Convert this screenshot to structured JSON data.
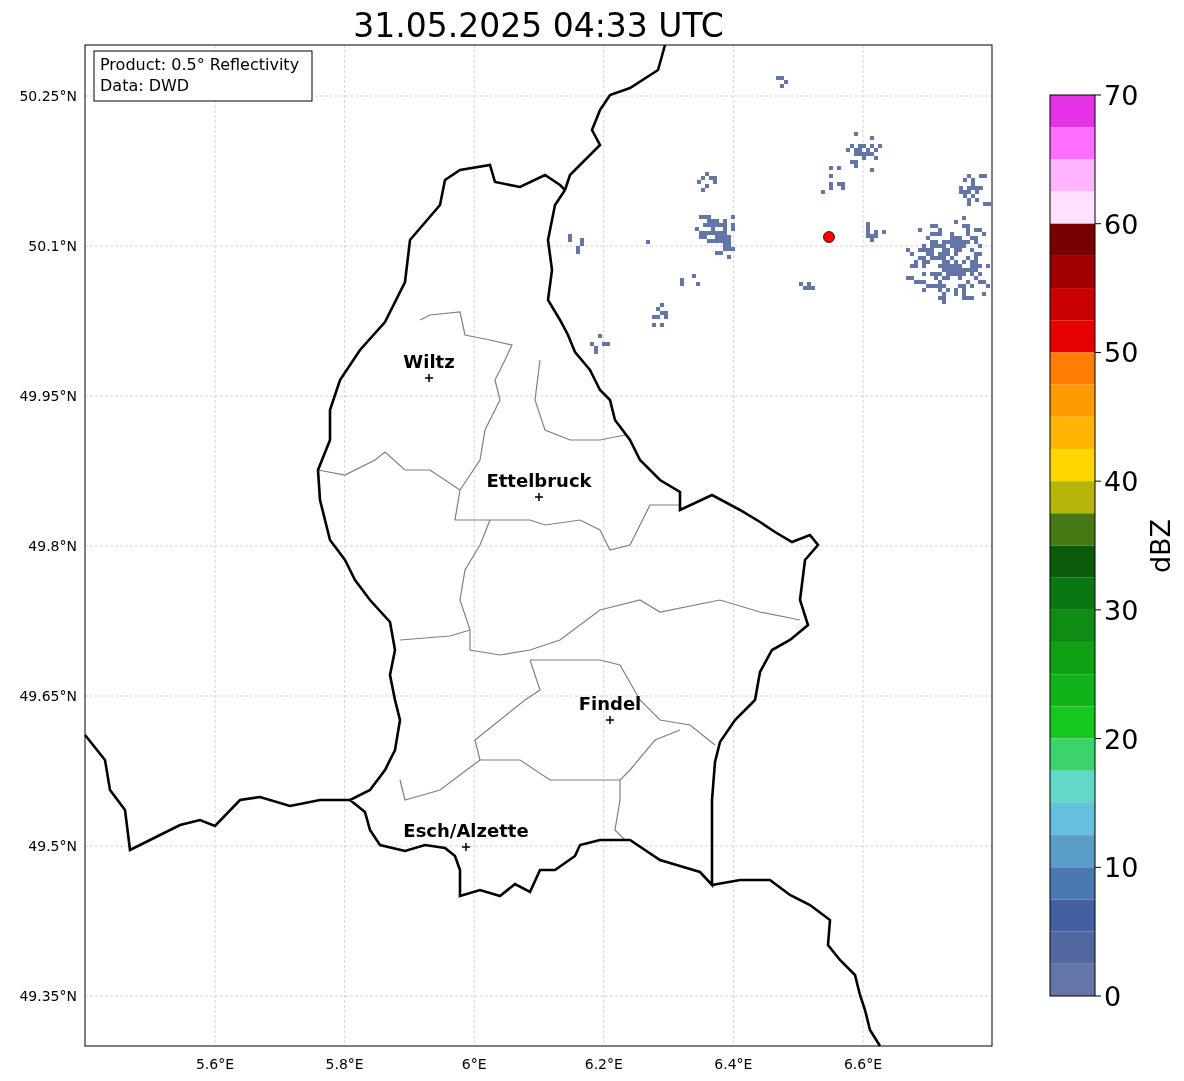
{
  "map": {
    "title": "31.05.2025 04:33 UTC",
    "grid": true,
    "xtick_labels": [
      "5.6°E",
      "5.8°E",
      "6°E",
      "6.2°E",
      "6.4°E",
      "6.6°E"
    ],
    "ytick_labels": [
      "50.25°N",
      "50.1°N",
      "49.95°N",
      "49.8°N",
      "49.65°N",
      "49.5°N",
      "49.35°N"
    ],
    "cities": [
      {
        "name": "Wiltz"
      },
      {
        "name": "Ettelbruck"
      },
      {
        "name": "Findel"
      },
      {
        "name": "Esch/Alzette"
      }
    ]
  },
  "info_box": [
    "Product: 0.5° Reflectivity",
    "Data: DWD"
  ],
  "colorbar": {
    "label": "dBZ",
    "ticks": [
      "70",
      "60",
      "50",
      "40",
      "30",
      "20",
      "10",
      "0"
    ],
    "segments": [
      {
        "color": "#e632e6"
      },
      {
        "color": "#ff6eff"
      },
      {
        "color": "#ffb4ff"
      },
      {
        "color": "#ffe0ff"
      },
      {
        "color": "#780000"
      },
      {
        "color": "#a00000"
      },
      {
        "color": "#c80000"
      },
      {
        "color": "#e60000"
      },
      {
        "color": "#ff7d00"
      },
      {
        "color": "#ff9b00"
      },
      {
        "color": "#ffb400"
      },
      {
        "color": "#ffd700"
      },
      {
        "color": "#b4b40a"
      },
      {
        "color": "#467814"
      },
      {
        "color": "#0a5c0a"
      },
      {
        "color": "#0a7812"
      },
      {
        "color": "#0e8c14"
      },
      {
        "color": "#10a014"
      },
      {
        "color": "#10b41a"
      },
      {
        "color": "#14c81e"
      },
      {
        "color": "#3cd26e"
      },
      {
        "color": "#64d8c8"
      },
      {
        "color": "#64c0dc"
      },
      {
        "color": "#5a9ec8"
      },
      {
        "color": "#4a78b0"
      },
      {
        "color": "#4460a0"
      },
      {
        "color": "#5468a0"
      },
      {
        "color": "#6675a8"
      }
    ]
  }
}
